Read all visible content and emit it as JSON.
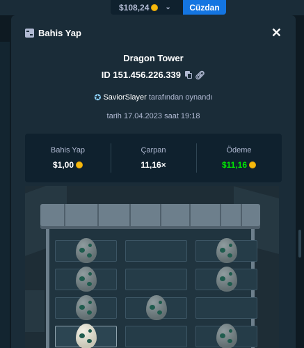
{
  "topbar": {
    "balance": "$108,24",
    "wallet_label": "Cüzdan"
  },
  "modal": {
    "title": "Bahis Yap",
    "close_symbol": "✕",
    "game_name": "Dragon Tower",
    "bet_id": "ID 151.456.226.339",
    "player_name": "SaviorSlayer",
    "played_by_suffix": "tarafından oynandı",
    "date_text": "tarih 17.04.2023 saat 19:18",
    "stats": {
      "bet": {
        "label": "Bahis Yap",
        "value": "$1,00"
      },
      "multiplier": {
        "label": "Çarpan",
        "value": "11,16×"
      },
      "payout": {
        "label": "Ödeme",
        "value": "$11,16"
      }
    }
  },
  "colors": {
    "background": "#0f212e",
    "panel": "#1a2c38",
    "wallet_blue": "#1475e1",
    "payout_green": "#00e701",
    "muted_text": "#b1bad3"
  },
  "board": {
    "rows": [
      [
        "egg",
        "empty",
        "egg"
      ],
      [
        "egg",
        "empty",
        "egg"
      ],
      [
        "egg",
        "egg",
        "empty"
      ],
      [
        "egg-selected",
        "empty",
        "egg"
      ]
    ]
  },
  "icons": {
    "title": "bet-slip-icon",
    "copy": "copy-icon",
    "link": "link-icon",
    "star": "star-icon",
    "coin": "coin-icon",
    "chevron": "chevron-down-icon"
  }
}
